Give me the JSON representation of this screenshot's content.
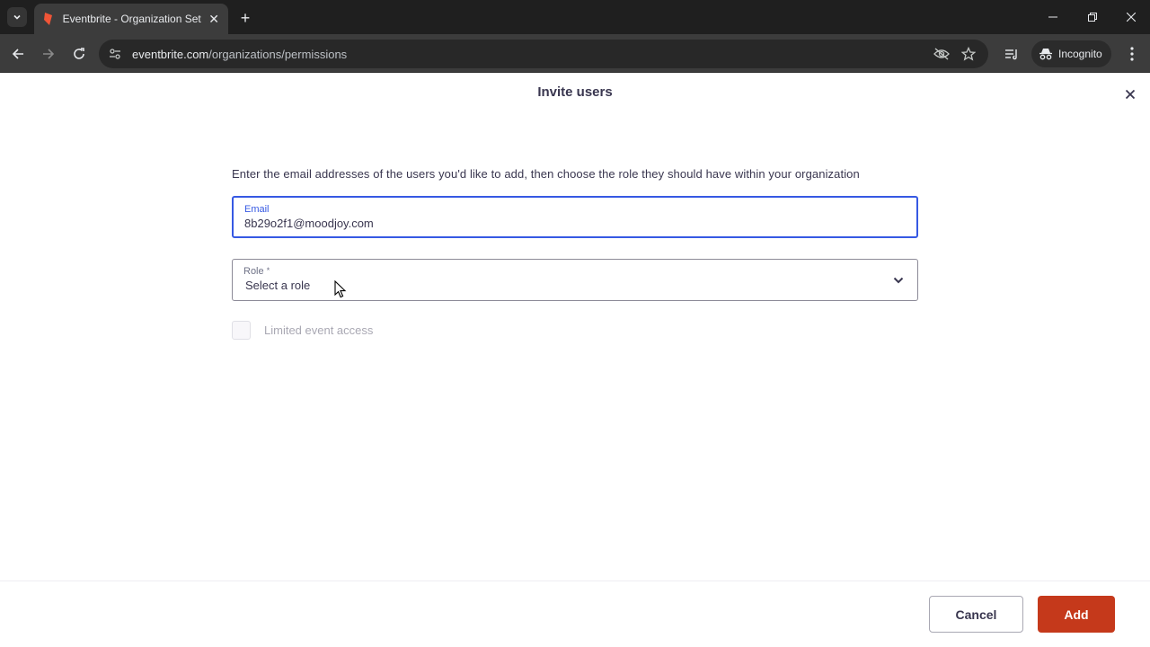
{
  "browser": {
    "tab_title": "Eventbrite - Organization Settings",
    "url_domain": "eventbrite.com",
    "url_path": "/organizations/permissions",
    "incognito_label": "Incognito"
  },
  "modal": {
    "title": "Invite users",
    "intro": "Enter the email addresses of the users you'd like to add, then choose the role they should have within your organization",
    "email": {
      "label": "Email",
      "value": "8b29o2f1@moodjoy.com"
    },
    "role": {
      "label": "Role",
      "required_mark": "*",
      "placeholder": "Select a role"
    },
    "limited_access_label": "Limited event access",
    "cancel_label": "Cancel",
    "add_label": "Add"
  },
  "colors": {
    "brand": "#c5391b",
    "focus": "#3659e3",
    "text": "#39364f"
  }
}
